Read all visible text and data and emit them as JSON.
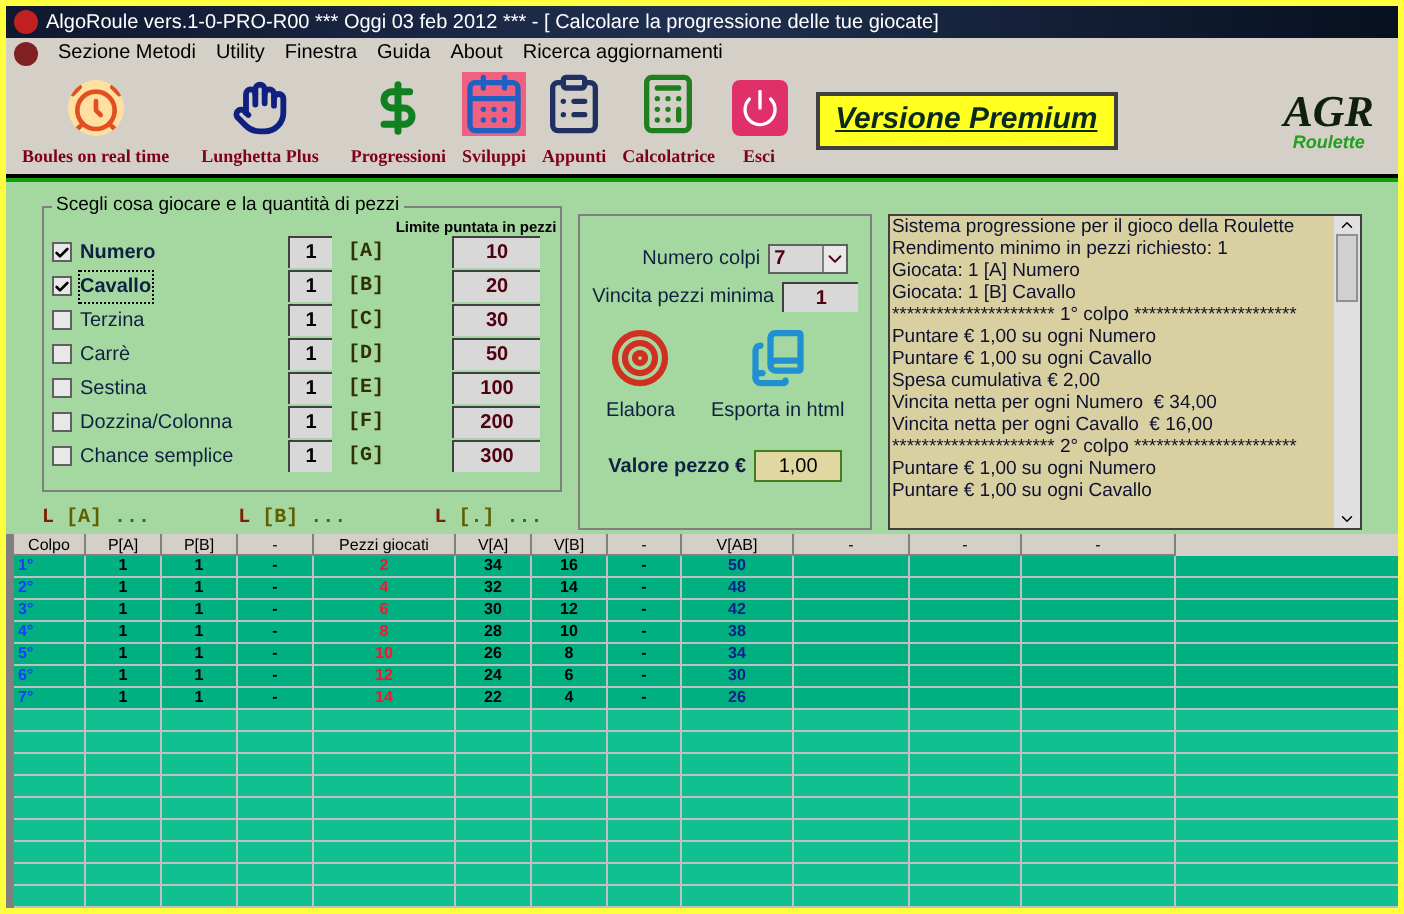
{
  "window": {
    "title": "AlgoRoule vers.1-0-PRO-R00  ***  Oggi 03 feb 2012  ***  - [ Calcolare la progressione delle tue giocate]"
  },
  "menu": [
    "Sezione Metodi",
    "Utility",
    "Finestra",
    "Guida",
    "About",
    "Ricerca aggiornamenti"
  ],
  "toolbar": [
    {
      "kind": "clock",
      "label": "Boules on real time"
    },
    {
      "kind": "hand",
      "label": "Lunghetta Plus"
    },
    {
      "kind": "dollar",
      "label": "Progressioni"
    },
    {
      "kind": "calendar",
      "label": "Sviluppi"
    },
    {
      "kind": "clipboard",
      "label": "Appunti"
    },
    {
      "kind": "calculator",
      "label": "Calcolatrice"
    },
    {
      "kind": "power",
      "label": "Esci"
    }
  ],
  "banner": "Versione Premium",
  "logo": {
    "letters": "AGR",
    "caption": "Roulette"
  },
  "bets_panel": {
    "title": "Scegli cosa giocare e la quantità di pezzi",
    "limit_header": "Limite puntata in pezzi",
    "items": [
      {
        "label": "Numero",
        "checked": true,
        "focused": false,
        "pieces": "1",
        "code": "[A]",
        "limit": "10"
      },
      {
        "label": "Cavallo",
        "checked": true,
        "focused": true,
        "pieces": "1",
        "code": "[B]",
        "limit": "20"
      },
      {
        "label": "Terzina",
        "checked": false,
        "focused": false,
        "pieces": "1",
        "code": "[C]",
        "limit": "30"
      },
      {
        "label": "Carrè",
        "checked": false,
        "focused": false,
        "pieces": "1",
        "code": "[D]",
        "limit": "50"
      },
      {
        "label": "Sestina",
        "checked": false,
        "focused": false,
        "pieces": "1",
        "code": "[E]",
        "limit": "100"
      },
      {
        "label": "Dozzina/Colonna",
        "checked": false,
        "focused": false,
        "pieces": "1",
        "code": "[F]",
        "limit": "200"
      },
      {
        "label": "Chance semplice",
        "checked": false,
        "focused": false,
        "pieces": "1",
        "code": "[G]",
        "limit": "300"
      }
    ],
    "legend": [
      {
        "letter": "L",
        "code": "[A]",
        "dots": "..."
      },
      {
        "letter": "L",
        "code": "[B]",
        "dots": "..."
      },
      {
        "letter": "L",
        "code": "[.]",
        "dots": "..."
      }
    ]
  },
  "controls": {
    "colpi_label": "Numero colpi",
    "colpi_value": "7",
    "vincita_label": "Vincita pezzi minima",
    "vincita_value": "1",
    "buttons": [
      {
        "kind": "target",
        "label": "Elabora"
      },
      {
        "kind": "books",
        "label": "Esporta in html"
      }
    ],
    "valore_label": "Valore pezzo €",
    "valore_value": "1,00"
  },
  "log": [
    "Sistema progressione per il gioco della Roulette",
    "Rendimento minimo in pezzi richiesto: 1",
    "Giocata: 1 [A] Numero",
    "Giocata: 1 [B] Cavallo",
    "********************** 1° colpo **********************",
    "Puntare € 1,00 su ogni Numero",
    "Puntare € 1,00 su ogni Cavallo",
    "Spesa cumulativa € 2,00",
    "Vincita netta per ogni Numero  € 34,00",
    "Vincita netta per ogni Cavallo  € 16,00",
    "********************** 2° colpo **********************",
    "Puntare € 1,00 su ogni Numero",
    "Puntare € 1,00 su ogni Cavallo"
  ],
  "table": {
    "columns": [
      "Colpo",
      "P[A]",
      "P[B]",
      "-",
      "Pezzi giocati",
      "V[A]",
      "V[B]",
      "-",
      "V[AB]",
      "-",
      "-",
      "-"
    ],
    "rows": [
      [
        "1°",
        "1",
        "1",
        "-",
        "2",
        "34",
        "16",
        "-",
        "50"
      ],
      [
        "2°",
        "1",
        "1",
        "-",
        "4",
        "32",
        "14",
        "-",
        "48"
      ],
      [
        "3°",
        "1",
        "1",
        "-",
        "6",
        "30",
        "12",
        "-",
        "42"
      ],
      [
        "4°",
        "1",
        "1",
        "-",
        "8",
        "28",
        "10",
        "-",
        "38"
      ],
      [
        "5°",
        "1",
        "1",
        "-",
        "10",
        "26",
        "8",
        "-",
        "34"
      ],
      [
        "6°",
        "1",
        "1",
        "-",
        "12",
        "24",
        "6",
        "-",
        "30"
      ],
      [
        "7°",
        "1",
        "1",
        "-",
        "14",
        "22",
        "4",
        "-",
        "26"
      ]
    ]
  }
}
